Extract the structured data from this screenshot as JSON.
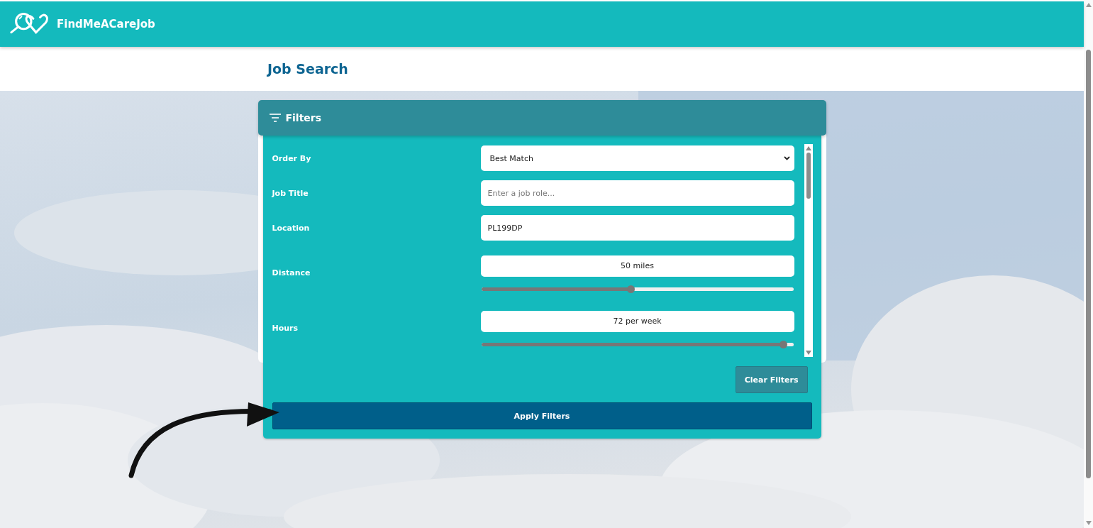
{
  "header": {
    "brand": "FindMeACareJob"
  },
  "page_title": "Job Search",
  "filters": {
    "title": "Filters",
    "fields": [
      {
        "kind": "select",
        "label": "Order By",
        "value": "Best Match"
      },
      {
        "kind": "text",
        "label": "Job Title",
        "placeholder": "Enter a job role..."
      },
      {
        "kind": "text",
        "label": "Location",
        "value": "PL199DP"
      },
      {
        "kind": "slider",
        "label": "Distance",
        "reading": "50 miles",
        "level": 0.48
      },
      {
        "kind": "slider",
        "label": "Hours",
        "reading": "72 per week",
        "level": 0.97
      }
    ],
    "clear_button": "Clear Filters",
    "apply_button": "Apply Filters"
  }
}
